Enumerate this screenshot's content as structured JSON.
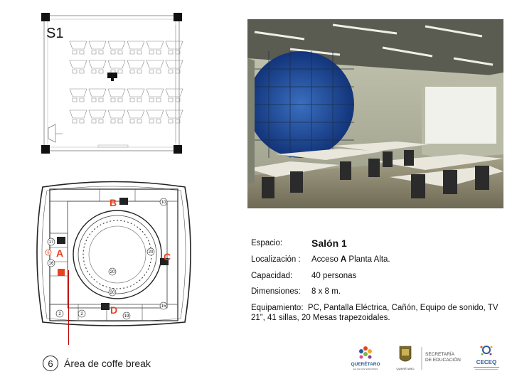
{
  "room_plan": {
    "label": "S1"
  },
  "building_plan": {
    "markers": [
      "A",
      "B",
      "C",
      "D"
    ],
    "room_numbers": [
      "17",
      "16",
      "20",
      "20",
      "20",
      "10",
      "19",
      "15",
      "2",
      "2",
      "6"
    ]
  },
  "legend": {
    "number": "6",
    "text": "Área de coffe break"
  },
  "info": {
    "space_label": "Espacio:",
    "space_value": "Salón 1",
    "location_label": "Localización :",
    "location_prefix": "Acceso ",
    "location_access": "A",
    "location_suffix": " Planta Alta.",
    "capacity_label": "Capacidad:",
    "capacity_value": "40 personas",
    "dimensions_label": "Dimensiones:",
    "dimensions_value": "8 x 8 m.",
    "equipment_label": "Equipamiento:",
    "equipment_value": "PC, Pantalla Eléctrica, Cañón, Equipo de sonido, TV 21”, 41 sillas, 20 Mesas trapezoidales."
  },
  "logos": {
    "queretaro": "QUERÉTARO",
    "queretaro_sub": "ES UN SUS NOSOTROS",
    "municipio": "QUERÉTARO",
    "secretaria": "SECRETARÍA",
    "educacion": "DE EDUCACIÓN",
    "ceceq": "CECEQ"
  },
  "colors": {
    "marker": "#e8421f",
    "leader": "#c00000",
    "accent_blue": "#2a5a9a"
  }
}
